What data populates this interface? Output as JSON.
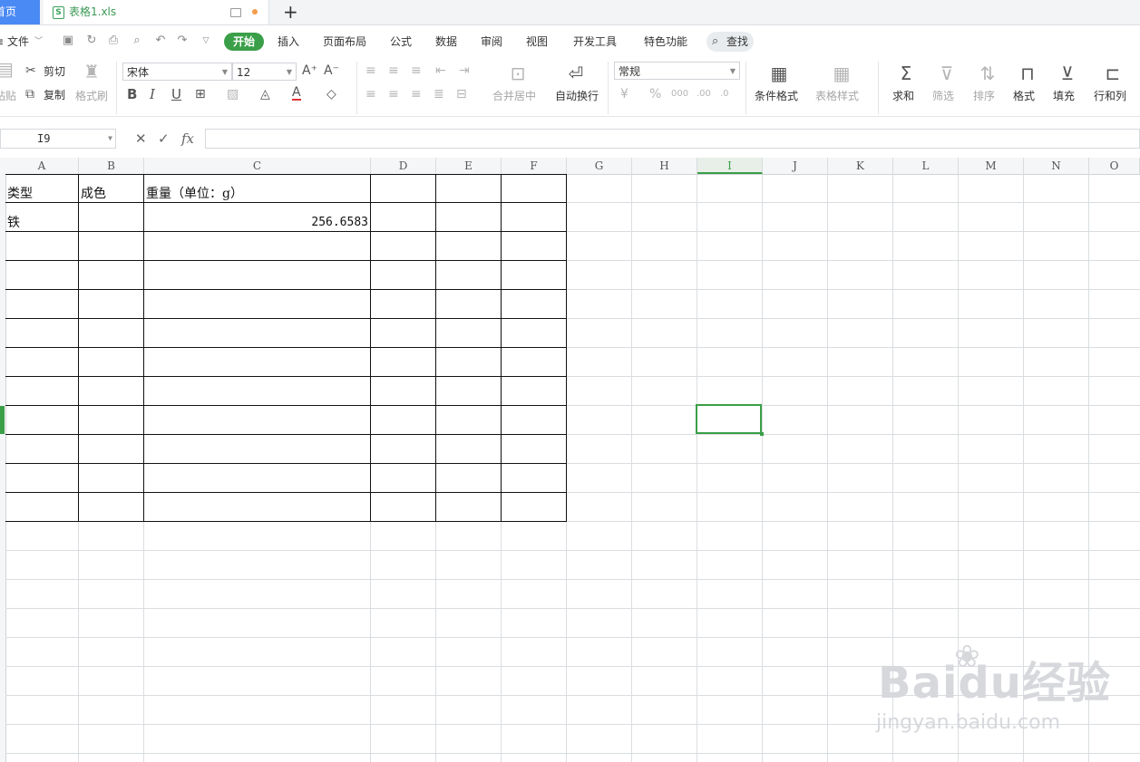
{
  "tabs": {
    "home_label": "首页",
    "doc_icon_letter": "S",
    "doc_name": "表格1.xls",
    "add_label": "+"
  },
  "menu": {
    "menu_icon": "≡",
    "file": "文件",
    "items": [
      "开始",
      "插入",
      "页面布局",
      "公式",
      "数据",
      "审阅",
      "视图",
      "开发工具",
      "特色功能"
    ],
    "active": "开始",
    "search": "查找"
  },
  "ribbon": {
    "paste": "粘贴",
    "cut": "剪切",
    "copy": "复制",
    "format_painter": "格式刷",
    "font_name": "宋体",
    "font_size": "12",
    "merge_center": "合并居中",
    "wrap_text": "自动换行",
    "number_format": "常规",
    "conditional_format": "条件格式",
    "table_style": "表格样式",
    "sum": "求和",
    "filter": "筛选",
    "sort": "排序",
    "format": "格式",
    "fill": "填充",
    "row_col": "行和列"
  },
  "formula_bar": {
    "name_box": "I9",
    "formula": ""
  },
  "sheet": {
    "columns": [
      "A",
      "B",
      "C",
      "D",
      "E",
      "F",
      "G",
      "H",
      "I",
      "J",
      "K",
      "L",
      "M",
      "N",
      "O"
    ],
    "selected_column": "I",
    "cells": {
      "a1": "类型",
      "b1": "成色",
      "c1": "重量（单位：g）",
      "a2": "铁",
      "c2": "256.6583"
    }
  },
  "watermark": {
    "brand": "Baidu",
    "brand_suffix": "经验",
    "url": "jingyan.baidu.com"
  },
  "colors": {
    "accent_green": "#3a9f48",
    "home_tab_blue": "#4a8af4"
  }
}
